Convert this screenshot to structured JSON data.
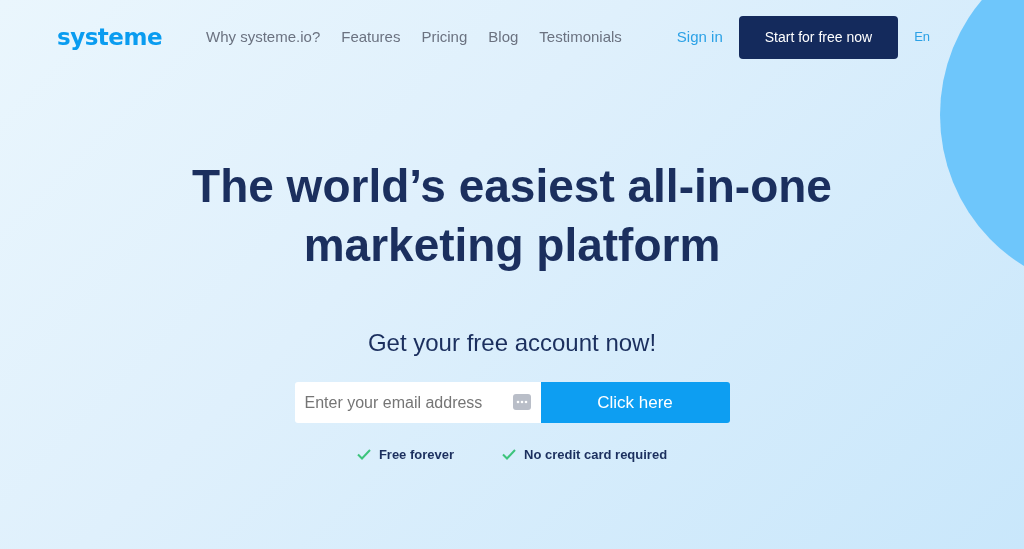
{
  "brand": {
    "logo": "systeme"
  },
  "nav": {
    "links": [
      "Why systeme.io?",
      "Features",
      "Pricing",
      "Blog",
      "Testimonials"
    ],
    "sign_in": "Sign in",
    "cta": "Start for free now",
    "language": "En"
  },
  "hero": {
    "headline_lines": [
      "The world’s easiest all-in-one",
      "marketing platform"
    ],
    "subtitle": "Get your free account now!",
    "email": {
      "placeholder": "Enter your email address"
    },
    "submit": "Click here",
    "perks": [
      "Free forever",
      "No credit card required"
    ]
  }
}
